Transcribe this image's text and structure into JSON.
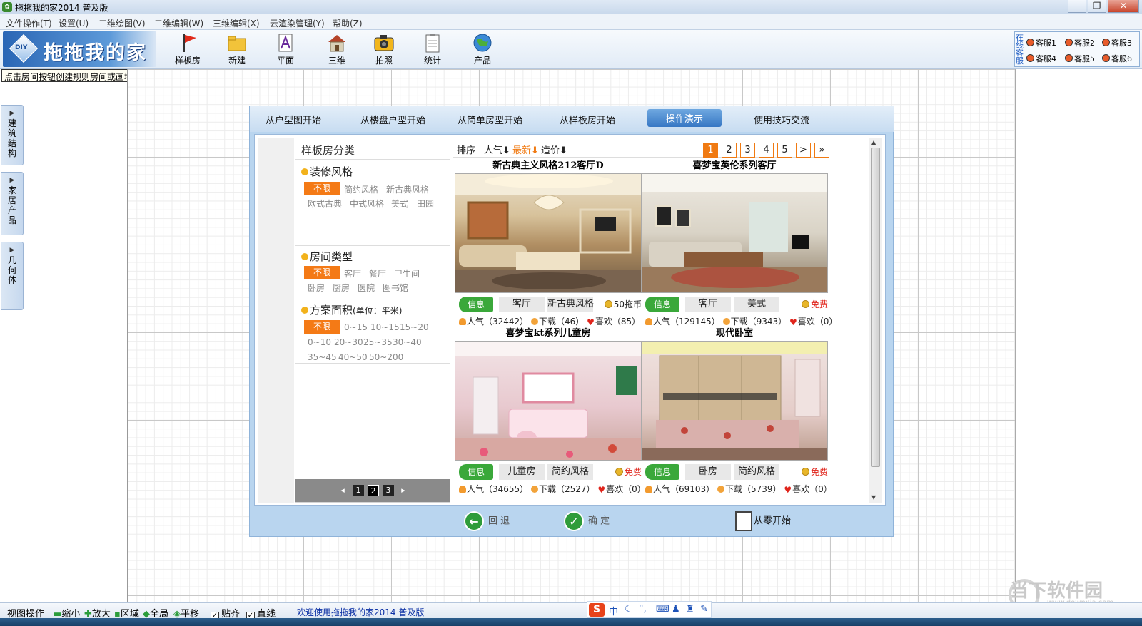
{
  "window": {
    "title": "拖拖我的家2014 普及版",
    "buttons": [
      "—",
      "❐",
      "✕"
    ]
  },
  "menu": [
    "文件操作(T)",
    "设置(U)",
    "二维绘图(V)",
    "二维编辑(W)",
    "三维编辑(X)",
    "云渲染管理(Y)",
    "帮助(Z)"
  ],
  "logo": {
    "text": "拖拖我的家",
    "badge": "DIY"
  },
  "toolbar": [
    {
      "label": "样板房",
      "icon": "flag-icon"
    },
    {
      "label": "新建",
      "icon": "folder-icon"
    },
    {
      "label": "平面",
      "icon": "plan-icon"
    },
    {
      "label": "三维",
      "icon": "house-3d-icon"
    },
    {
      "label": "拍照",
      "icon": "camera-icon"
    },
    {
      "label": "统计",
      "icon": "clipboard-icon"
    },
    {
      "label": "产品",
      "icon": "globe-icon"
    }
  ],
  "service": {
    "title": "在线客服",
    "items": [
      "客服1",
      "客服2",
      "客服3",
      "客服4",
      "客服5",
      "客服6"
    ]
  },
  "hint": "点击房间按钮创建规则房间或画墙绘制任意户型",
  "left_tabs": [
    "建筑结构",
    "家居产品",
    "几何体"
  ],
  "dialog": {
    "tabs": [
      "从户型图开始",
      "从楼盘户型开始",
      "从简单房型开始",
      "从样板房开始",
      "操作演示",
      "使用技巧交流"
    ],
    "active_tab": "操作演示",
    "category_title": "样板房分类",
    "sections": [
      {
        "title": "装修风格",
        "options": [
          "不限",
          "简约风格",
          "新古典风格",
          "欧式古典",
          "中式风格",
          "美式",
          "田园"
        ]
      },
      {
        "title": "房间类型",
        "options": [
          "不限",
          "客厅",
          "餐厅",
          "卫生间",
          "卧房",
          "厨房",
          "医院",
          "图书馆"
        ]
      },
      {
        "title": "方案面积",
        "unit": "(单位：平米)",
        "options": [
          "不限",
          "0~15",
          "10~15",
          "15~20",
          "0~10",
          "20~30",
          "25~35",
          "30~40",
          "35~45",
          "40~50",
          "50~200"
        ]
      }
    ],
    "left_pager": {
      "prev": "◂",
      "pages": [
        "1",
        "2",
        "3"
      ],
      "next": "▸"
    },
    "sort": {
      "label": "排序",
      "items": [
        "人气⬇",
        "最新⬇",
        "造价⬇"
      ]
    },
    "pager": [
      "1",
      "2",
      "3",
      "4",
      "5",
      ">",
      "»"
    ],
    "cards": [
      {
        "title": "新古典主义风格212客厅D",
        "info": "信息",
        "room": "客厅",
        "style": "新古典风格",
        "price": "50拖币",
        "popularity": "人气（32442）",
        "downloads": "下载（46）",
        "likes": "喜欢（85）"
      },
      {
        "title": "喜梦宝英伦系列客厅",
        "info": "信息",
        "room": "客厅",
        "style": "美式",
        "price": "免费",
        "popularity": "人气（129145）",
        "downloads": "下载（9343）",
        "likes": "喜欢（0）"
      },
      {
        "title": "喜梦宝kt系列儿童房",
        "info": "信息",
        "room": "儿童房",
        "style": "简约风格",
        "price": "免费",
        "popularity": "人气（34655）",
        "downloads": "下载（2527）",
        "likes": "喜欢（0）"
      },
      {
        "title": "现代卧室",
        "info": "信息",
        "room": "卧房",
        "style": "简约风格",
        "price": "免费",
        "popularity": "人气（69103）",
        "downloads": "下载（5739）",
        "likes": "喜欢（0）"
      }
    ],
    "footer": {
      "back": "回 退",
      "ok": "确 定",
      "start": "从零开始"
    }
  },
  "statusbar": {
    "view_ops": "视图操作",
    "zoom_out": "缩小",
    "zoom_in": "放大",
    "region": "区域",
    "global": "全局",
    "pan": "平移",
    "snap": "贴齐",
    "line": "直线",
    "welcome": "欢迎使用拖拖我的家2014 普及版"
  },
  "ime": {
    "logo": "S",
    "lang": "中"
  },
  "watermark": {
    "text": "当下软件园",
    "url": "www.downxia.com"
  },
  "colors": {
    "accent": "#f07a12",
    "info_green": "#3aa83a",
    "dialog_bg": "#b9d5ef",
    "active_tab": "#3777c4"
  }
}
